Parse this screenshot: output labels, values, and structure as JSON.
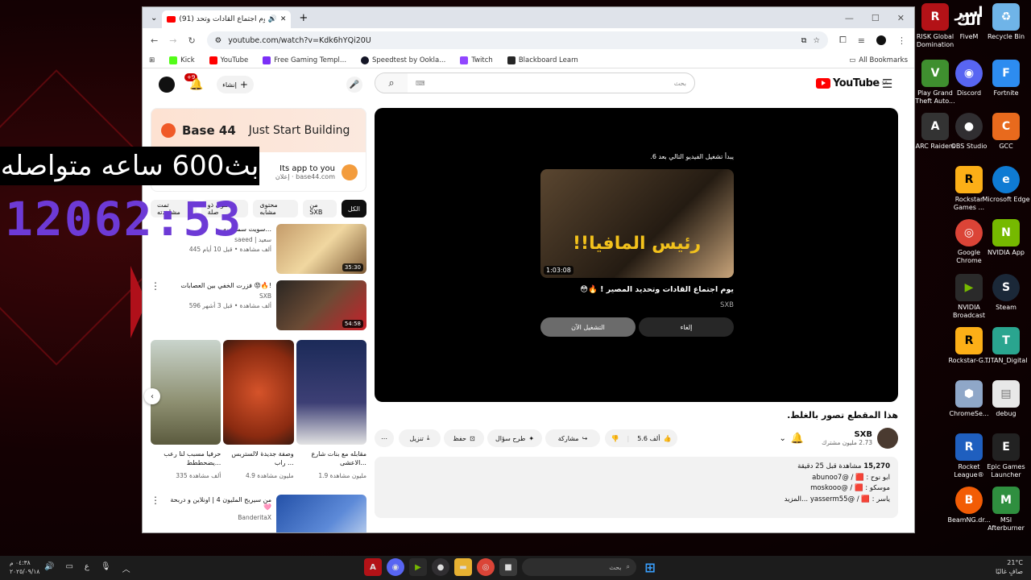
{
  "overlay": {
    "stream_text": "بث600 ساعه متواصله",
    "timer": "12062:53"
  },
  "desktop": {
    "corner_logo": "اسر الك",
    "icons": [
      {
        "label": "RISK Global Domination",
        "color": "#b31217"
      },
      {
        "label": "FiveM",
        "color": "#f26b1f"
      },
      {
        "label": "Recycle Bin",
        "color": "#6fb4e8"
      },
      {
        "label": "Play Grand Theft Auto...",
        "color": "#3f8f2f"
      },
      {
        "label": "Discord",
        "color": "#5865f2"
      },
      {
        "label": "Fortnite",
        "color": "#2d8cf0"
      },
      {
        "label": "ARC Raiders",
        "color": "#333333"
      },
      {
        "label": "OBS Studio",
        "color": "#302e31"
      },
      {
        "label": "GCC",
        "color": "#e86a1d"
      },
      {
        "label": "Rockstar Games ...",
        "color": "#fcaf17"
      },
      {
        "label": "Microsoft Edge",
        "color": "#0f7bd3"
      },
      {
        "label": "Google Chrome",
        "color": "#db4437"
      },
      {
        "label": "NVIDIA App",
        "color": "#76b900"
      },
      {
        "label": "NVIDIA Broadcast",
        "color": "#76b900"
      },
      {
        "label": "Steam",
        "color": "#1b2838"
      },
      {
        "label": "Rockstar-G...",
        "color": "#fcaf17"
      },
      {
        "label": "TITAN_Digital",
        "color": "#2aa58f"
      },
      {
        "label": "ChromeSe...",
        "color": "#8fa7c8"
      },
      {
        "label": "debug",
        "color": "#e8e8e8"
      },
      {
        "label": "Rocket League®",
        "color": "#1f5fbf"
      },
      {
        "label": "Epic Games Launcher",
        "color": "#222222"
      },
      {
        "label": "BeamNG.dr...",
        "color": "#f25c05"
      },
      {
        "label": "MSI Afterburner",
        "color": "#2f8f3f"
      }
    ]
  },
  "browser": {
    "tab_title": "(91) يوم اجتماع القادات وتحد...",
    "url": "youtube.com/watch?v=Kdk6hYQi20U",
    "bookmarks": [
      {
        "label": "Kick",
        "color": "#53fc18"
      },
      {
        "label": "YouTube",
        "color": "#ff0000"
      },
      {
        "label": "Free Gaming Templ...",
        "color": "#7b2ff7"
      },
      {
        "label": "Speedtest by Ookla...",
        "color": "#141526"
      },
      {
        "label": "Twitch",
        "color": "#9146ff"
      },
      {
        "label": "Blackboard Learn",
        "color": "#262626"
      }
    ],
    "all_bookmarks": "All Bookmarks"
  },
  "youtube": {
    "create_label": "إنشاء",
    "notif_count": "+9",
    "search_placeholder": "بحث",
    "logo": "YouTube",
    "region": "SA",
    "ad": {
      "brand": "Base 44",
      "tagline": "Just Start Building",
      "title": "Its app to you",
      "sponsor": "إعلان",
      "domain": "base44.com"
    },
    "chips": [
      "الكل",
      "من SXB",
      "محتوى مشابه",
      "محتوى ذو صلة",
      "تمت مشاهدته"
    ],
    "related": [
      {
        "title": "سويت سمبوسه...",
        "channel": "saeed | سعيد",
        "meta": "445 ألف مشاهدة • قبل 10 أيام",
        "duration": "35:30"
      },
      {
        "title": "فزرت الخفي بين العصابات 😡🔥!",
        "channel": "SXB",
        "meta": "596 ألف مشاهدة • قبل 3 أشهر",
        "duration": "54:58"
      }
    ],
    "shorts": [
      {
        "title": "مقابله مع بنات شارع الاعشى...",
        "views": "1.9 مليون مشاهدة"
      },
      {
        "title": "وصفة جديدة لالستربس راب ...",
        "views": "4.9 مليون مشاهدة"
      },
      {
        "title": "حرفيا مسبب لنا رعب يضحططط...",
        "views": "335 ألف مشاهدة"
      }
    ],
    "related_next": {
      "title": "من سيربح المليون 4 | اونلاين و دربحة 🩷",
      "channel": "BanderitaX"
    },
    "player": {
      "up_next": "يبدأ تشغيل الفيديو التالي بعد 6.",
      "thumb_title": "رئيس المافيا!!",
      "duration": "1:03:08",
      "title": "يوم اجتماع القادات وتحديد المصير ! 🔥😳",
      "channel": "SXB",
      "cancel": "إلغاء",
      "play_now": "التشغيل الآن"
    },
    "video_title": "هذا المقطع تصور بالغلط.",
    "owner": {
      "name": "SXB",
      "subs": "2.73 مليون مشترك"
    },
    "actions": {
      "likes": "5.6 ألف",
      "share": "مشاركة",
      "ask": "طرح سؤال",
      "save": "حفظ",
      "download": "تنزيل"
    },
    "description": {
      "views": "15,270",
      "line1_rest": "مشاهدة قبل 25 دقيقة",
      "line2": "ابو نوح : 🟥 / @abunoo7",
      "line3": "موسكو : 🟥 / @moskooo",
      "line4": "ياسر : 🟥 / @yasserm55",
      "more": "...المزيد"
    },
    "below_channel": "SXB"
  },
  "taskbar": {
    "time": "٠٤:٣٨ م",
    "date": "٢٠٢٥/٠٩/١٨",
    "lang": "ع",
    "search": "بحث",
    "temp": "21°C",
    "weather": "صافٍ غالبًا"
  }
}
